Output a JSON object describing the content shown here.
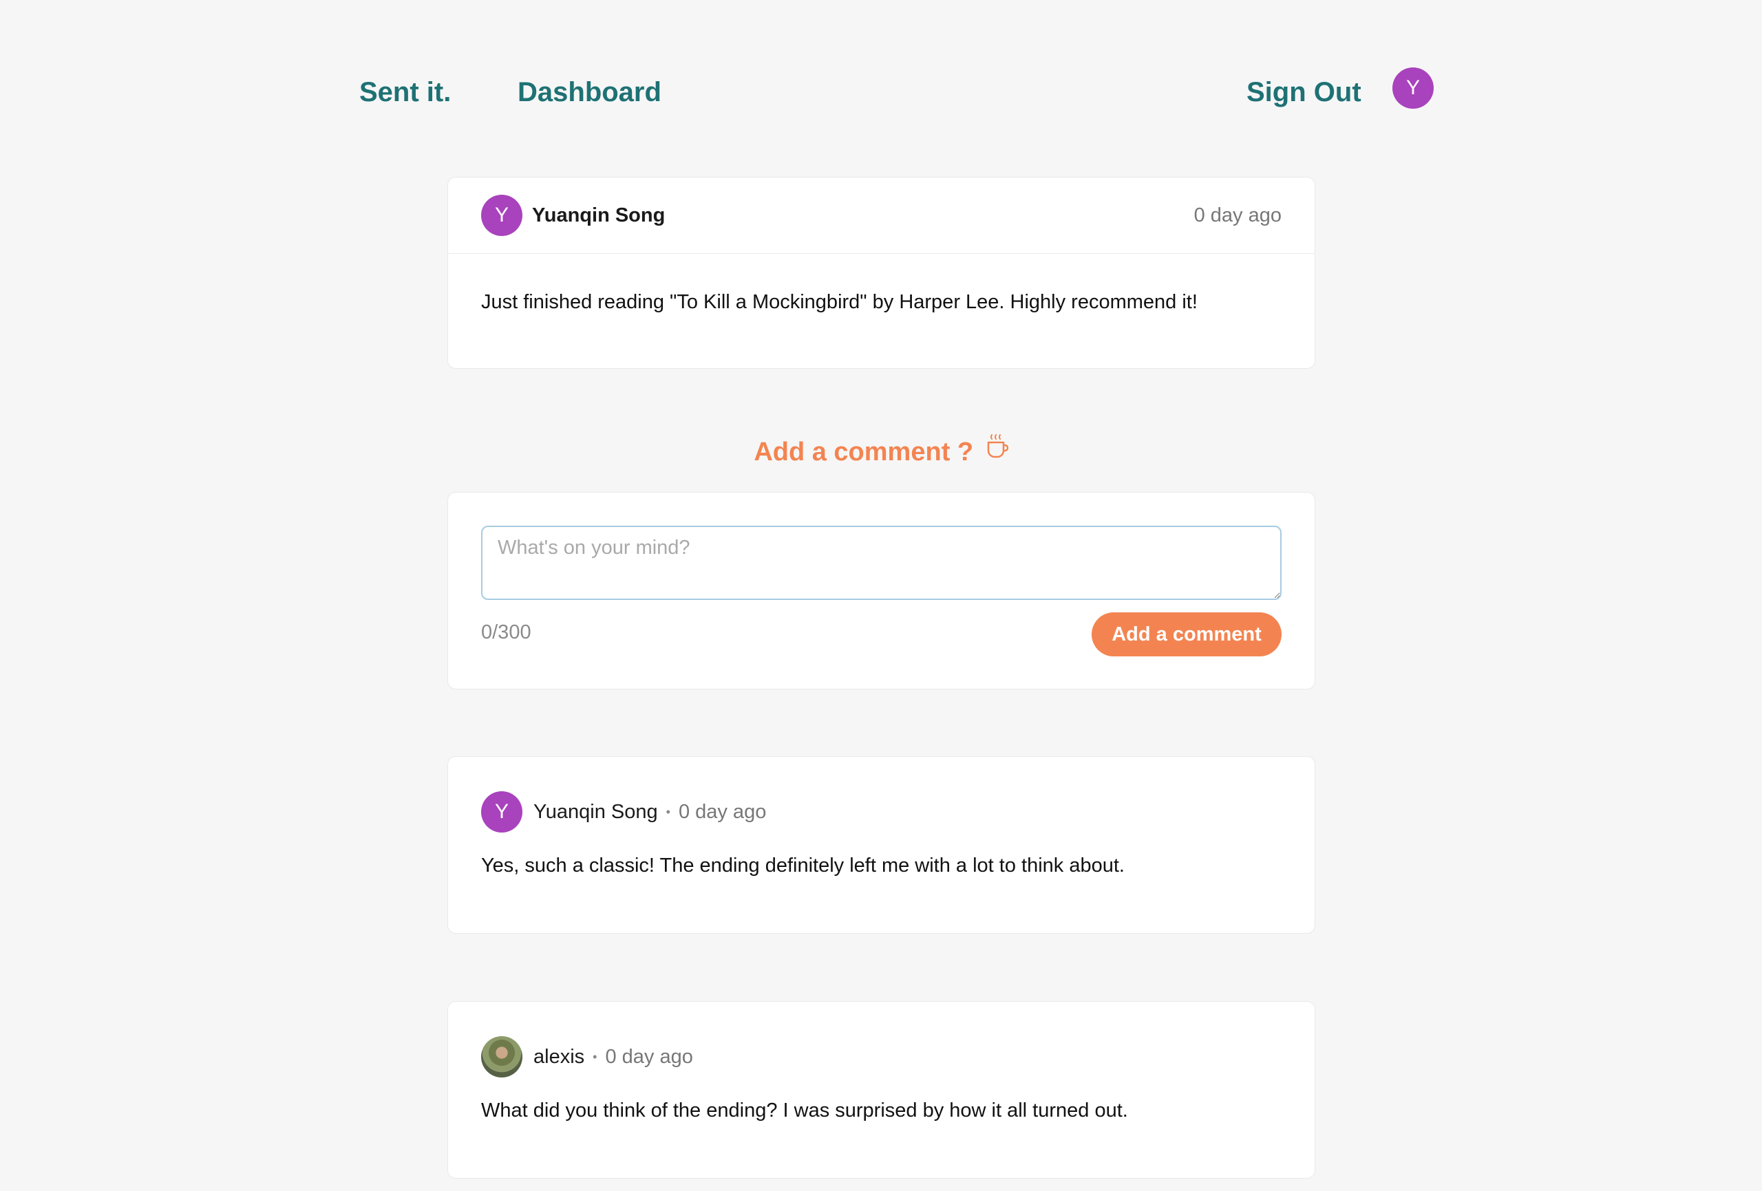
{
  "nav": {
    "brand": "Sent it.",
    "dashboard": "Dashboard",
    "signout": "Sign Out",
    "avatar_initial": "Y",
    "avatar_color": "#a942bd"
  },
  "post": {
    "author": "Yuanqin Song",
    "avatar_initial": "Y",
    "time": "0 day ago",
    "body": "Just finished reading \"To Kill a Mockingbird\" by Harper Lee. Highly recommend it!"
  },
  "compose": {
    "heading": "Add a comment ?",
    "heading_icon": "coffee-cup-icon",
    "placeholder": "What's on your mind?",
    "value": "",
    "counter": "0/300",
    "button": "Add a comment",
    "accent": "#f38451"
  },
  "comments": [
    {
      "author": "Yuanqin Song",
      "avatar_initial": "Y",
      "separator": "•",
      "time": "0 day ago",
      "body": "Yes, such a classic! The ending definitely left me with a lot to think about."
    },
    {
      "author": "alexis",
      "avatar": "photo-avatar",
      "separator": "•",
      "time": "0 day ago",
      "body": "What did you think of the ending? I was surprised by how it all turned out."
    }
  ],
  "colors": {
    "brand_teal": "#1e7174",
    "avatar_purple": "#a942bd",
    "background": "#f6f6f6"
  }
}
